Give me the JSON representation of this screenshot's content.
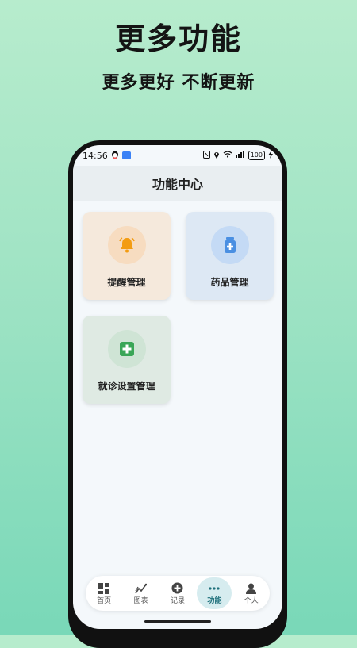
{
  "promo": {
    "title": "更多功能",
    "subtitle": "更多更好 不断更新"
  },
  "status_bar": {
    "time": "14:56",
    "battery": "100"
  },
  "app_bar": {
    "title": "功能中心"
  },
  "cards": [
    {
      "label": "提醒管理",
      "icon": "bell-icon",
      "accent": "#f39c12"
    },
    {
      "label": "药品管理",
      "icon": "medicine-bottle-icon",
      "accent": "#4a8fe2"
    },
    {
      "label": "就诊设置管理",
      "icon": "medical-cross-icon",
      "accent": "#3aa657"
    }
  ],
  "tabs": [
    {
      "label": "首页",
      "icon": "dashboard-icon",
      "active": false
    },
    {
      "label": "图表",
      "icon": "chart-icon",
      "active": false
    },
    {
      "label": "记录",
      "icon": "add-circle-icon",
      "active": false
    },
    {
      "label": "功能",
      "icon": "more-dots-icon",
      "active": true
    },
    {
      "label": "个人",
      "icon": "person-icon",
      "active": false
    }
  ],
  "colors": {
    "active_tab": "#1d6f7a",
    "background": "#9fe3c4"
  }
}
